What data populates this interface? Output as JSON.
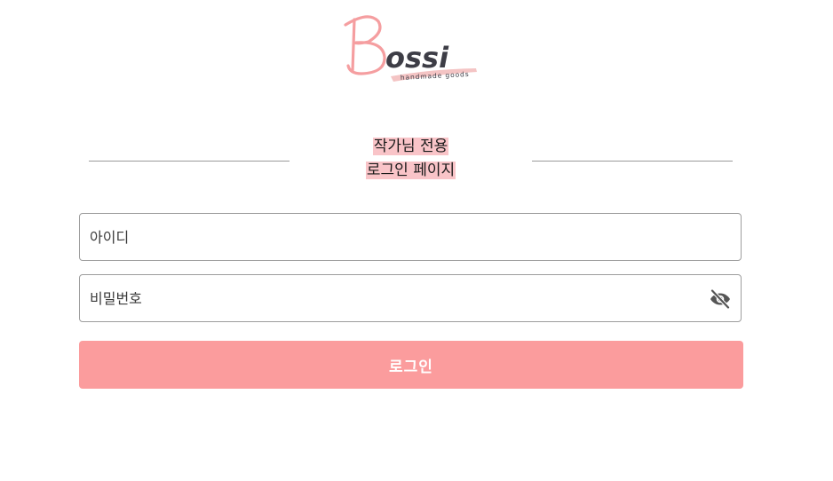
{
  "logo": {
    "brand": "Bossi",
    "initial": "B",
    "rest": "ossi",
    "tagline": "handmade goods",
    "colors": {
      "pink": "#f59ea0",
      "dark": "#3d3d46",
      "stripe": "#f4c4c4"
    }
  },
  "title": {
    "line1": "작가님 전용",
    "line2": "로그인 페이지",
    "highlight_color": "#f9c4c8"
  },
  "form": {
    "id_placeholder": "아이디",
    "id_value": "",
    "password_placeholder": "비밀번호",
    "password_value": "",
    "password_toggle_icon": "eye-off-icon",
    "login_label": "로그인",
    "login_color": "#fb9c9d"
  }
}
